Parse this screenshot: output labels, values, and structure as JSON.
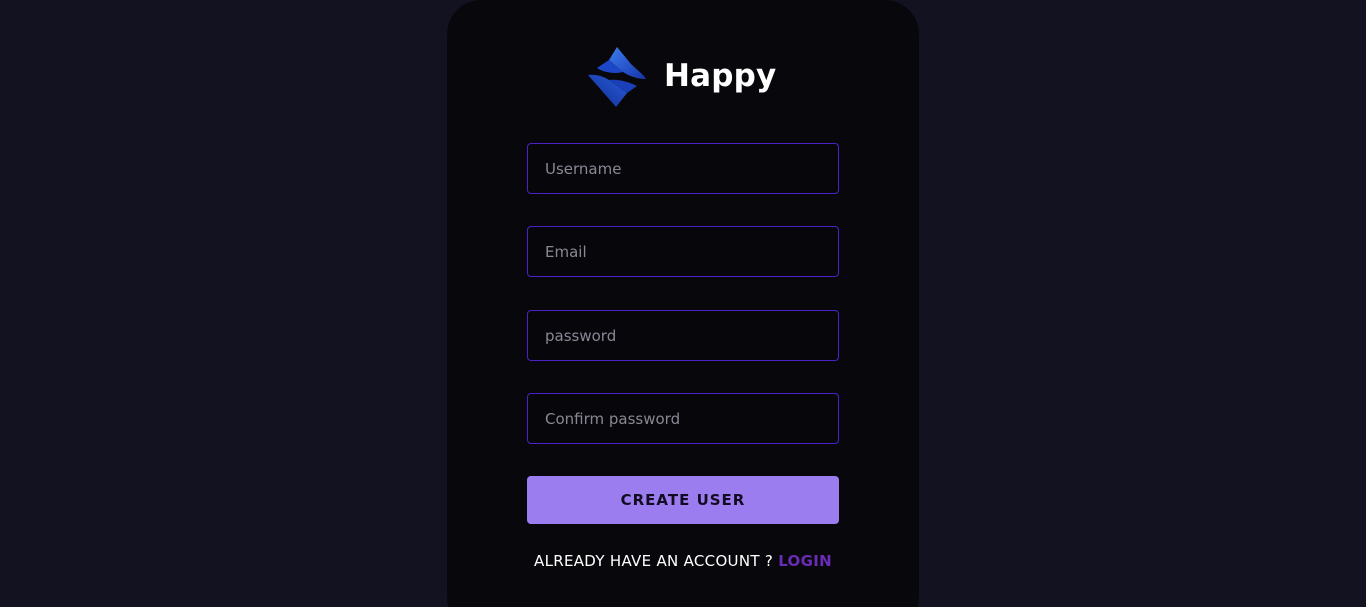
{
  "brand": {
    "name": "Happy",
    "logo_icon": "happy-logo-icon"
  },
  "form": {
    "username": {
      "value": "",
      "placeholder": "Username"
    },
    "email": {
      "value": "",
      "placeholder": "Email"
    },
    "password": {
      "value": "",
      "placeholder": "password"
    },
    "confirm_password": {
      "value": "",
      "placeholder": "Confirm password"
    },
    "submit_label": "CREATE USER"
  },
  "footer": {
    "prompt": "ALREADY HAVE AN ACCOUNT ?",
    "login_label": "LOGIN"
  },
  "colors": {
    "background": "#131221",
    "card": "#08080c",
    "field_border": "#4b22c7",
    "button": "#9b7df0",
    "link": "#6a2bb5"
  }
}
